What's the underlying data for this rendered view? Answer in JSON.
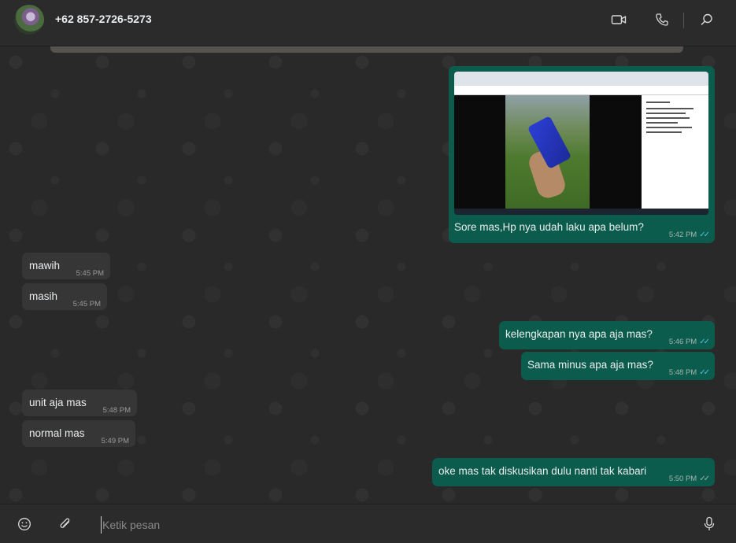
{
  "header": {
    "contact_name": "+62 857-2726-5273",
    "icons": [
      "video-call-icon",
      "voice-call-icon",
      "search-icon"
    ]
  },
  "messages": [
    {
      "direction": "out",
      "type": "image",
      "text": "Sore mas,Hp nya udah laku apa belum?",
      "time": "5:42 PM",
      "status": "read"
    },
    {
      "direction": "in",
      "text": "mawih",
      "time": "5:45 PM"
    },
    {
      "direction": "in",
      "text": "masih",
      "time": "5:45 PM"
    },
    {
      "direction": "out",
      "text": "kelengkapan nya apa aja mas?",
      "time": "5:46 PM",
      "status": "read"
    },
    {
      "direction": "out",
      "text": "Sama minus apa aja mas?",
      "time": "5:48 PM",
      "status": "read"
    },
    {
      "direction": "in",
      "text": "unit aja mas",
      "time": "5:48 PM"
    },
    {
      "direction": "in",
      "text": "normal mas",
      "time": "5:49 PM"
    },
    {
      "direction": "out",
      "text": "oke mas tak diskusikan dulu nanti tak kabari",
      "time": "5:50 PM",
      "status": "delivered"
    }
  ],
  "composer": {
    "placeholder": "Ketik pesan",
    "value": ""
  },
  "colors": {
    "outgoing_bubble": "#0b5c4c",
    "incoming_bubble": "#363636",
    "read_ticks": "#53bdeb"
  }
}
